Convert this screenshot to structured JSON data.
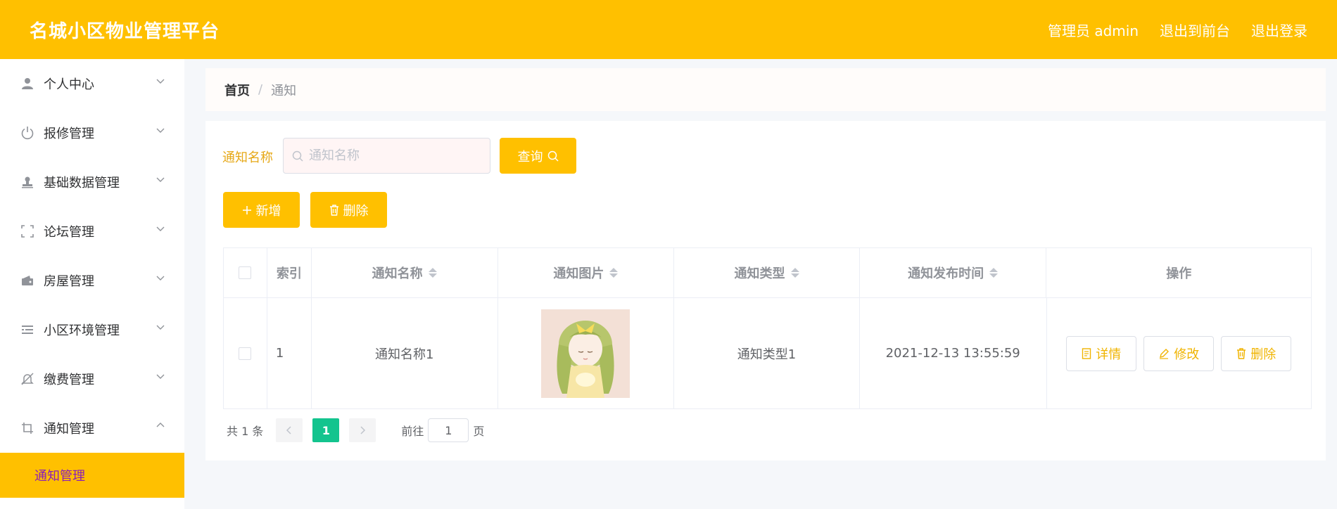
{
  "header": {
    "title": "名城小区物业管理平台",
    "admin_label": "管理员 admin",
    "to_front": "退出到前台",
    "logout": "退出登录"
  },
  "sidebar": {
    "items": [
      {
        "label": "个人中心",
        "icon": "user-icon"
      },
      {
        "label": "报修管理",
        "icon": "power-icon"
      },
      {
        "label": "基础数据管理",
        "icon": "stamp-icon"
      },
      {
        "label": "论坛管理",
        "icon": "frame-icon"
      },
      {
        "label": "房屋管理",
        "icon": "wallet-icon"
      },
      {
        "label": "小区环境管理",
        "icon": "list-icon"
      },
      {
        "label": "缴费管理",
        "icon": "bell-off-icon"
      },
      {
        "label": "通知管理",
        "icon": "crop-icon"
      }
    ],
    "sub_item": "通知管理"
  },
  "breadcrumb": {
    "home": "首页",
    "current": "通知"
  },
  "search": {
    "label": "通知名称",
    "placeholder": "通知名称",
    "query_label": "查询"
  },
  "toolbar": {
    "add_label": "新增",
    "delete_label": "删除"
  },
  "table": {
    "headers": {
      "index": "索引",
      "name": "通知名称",
      "image": "通知图片",
      "type": "通知类型",
      "time": "通知发布时间",
      "ops": "操作"
    },
    "rows": [
      {
        "index": "1",
        "name": "通知名称1",
        "type": "通知类型1",
        "time": "2021-12-13 13:55:59",
        "detail_label": "详情",
        "edit_label": "修改",
        "delete_label": "删除"
      }
    ]
  },
  "pagination": {
    "total": "共 1 条",
    "current_page": "1",
    "goto_prefix": "前往",
    "goto_value": "1",
    "goto_suffix": "页"
  },
  "colors": {
    "primary": "#ffc000",
    "active_page": "#13c48e",
    "submenu_text": "#8b1fb8"
  }
}
